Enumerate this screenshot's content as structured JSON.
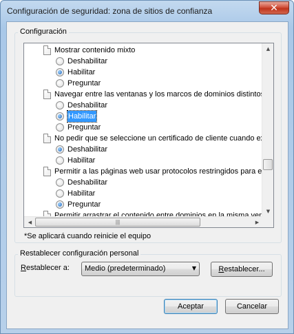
{
  "window": {
    "title": "Configuración de seguridad: zona de sitios de confianza",
    "close_glyph": "✕"
  },
  "config_group": {
    "legend": "Configuración",
    "items": [
      {
        "type": "heading",
        "label": "Mostrar contenido mixto"
      },
      {
        "type": "option",
        "label": "Deshabilitar",
        "checked": false
      },
      {
        "type": "option",
        "label": "Habilitar",
        "checked": true
      },
      {
        "type": "option",
        "label": "Preguntar",
        "checked": false
      },
      {
        "type": "heading",
        "label": "Navegar entre las ventanas y los marcos de dominios distintos"
      },
      {
        "type": "option",
        "label": "Deshabilitar",
        "checked": false
      },
      {
        "type": "option",
        "label": "Habilitar",
        "checked": true,
        "selected": true
      },
      {
        "type": "option",
        "label": "Preguntar",
        "checked": false
      },
      {
        "type": "heading",
        "label": "No pedir que se seleccione un certificado de cliente cuando exista"
      },
      {
        "type": "option",
        "label": "Deshabilitar",
        "checked": true
      },
      {
        "type": "option",
        "label": "Habilitar",
        "checked": false
      },
      {
        "type": "heading",
        "label": "Permitir a las páginas web usar protocolos restringidos para el contenido activo"
      },
      {
        "type": "option",
        "label": "Deshabilitar",
        "checked": false
      },
      {
        "type": "option",
        "label": "Habilitar",
        "checked": false
      },
      {
        "type": "option",
        "label": "Preguntar",
        "checked": true
      },
      {
        "type": "heading",
        "label": "Permitir arrastrar el contenido entre dominios en la misma ventana"
      }
    ],
    "note": "*Se aplicará cuando reinicie el equipo"
  },
  "reset_group": {
    "legend": "Restablecer configuración personal",
    "label_prefix": "R",
    "label_rest": "establecer a:",
    "select_value": "Medio (predeterminado)",
    "reset_button_prefix": "R",
    "reset_button_rest": "establecer..."
  },
  "buttons": {
    "accept": "Aceptar",
    "cancel": "Cancelar"
  },
  "icons": {
    "up_arrow": "▲",
    "down_arrow": "▼",
    "left_arrow": "◀",
    "right_arrow": "▶",
    "dropdown_arrow": "▼",
    "grip": "|||"
  }
}
